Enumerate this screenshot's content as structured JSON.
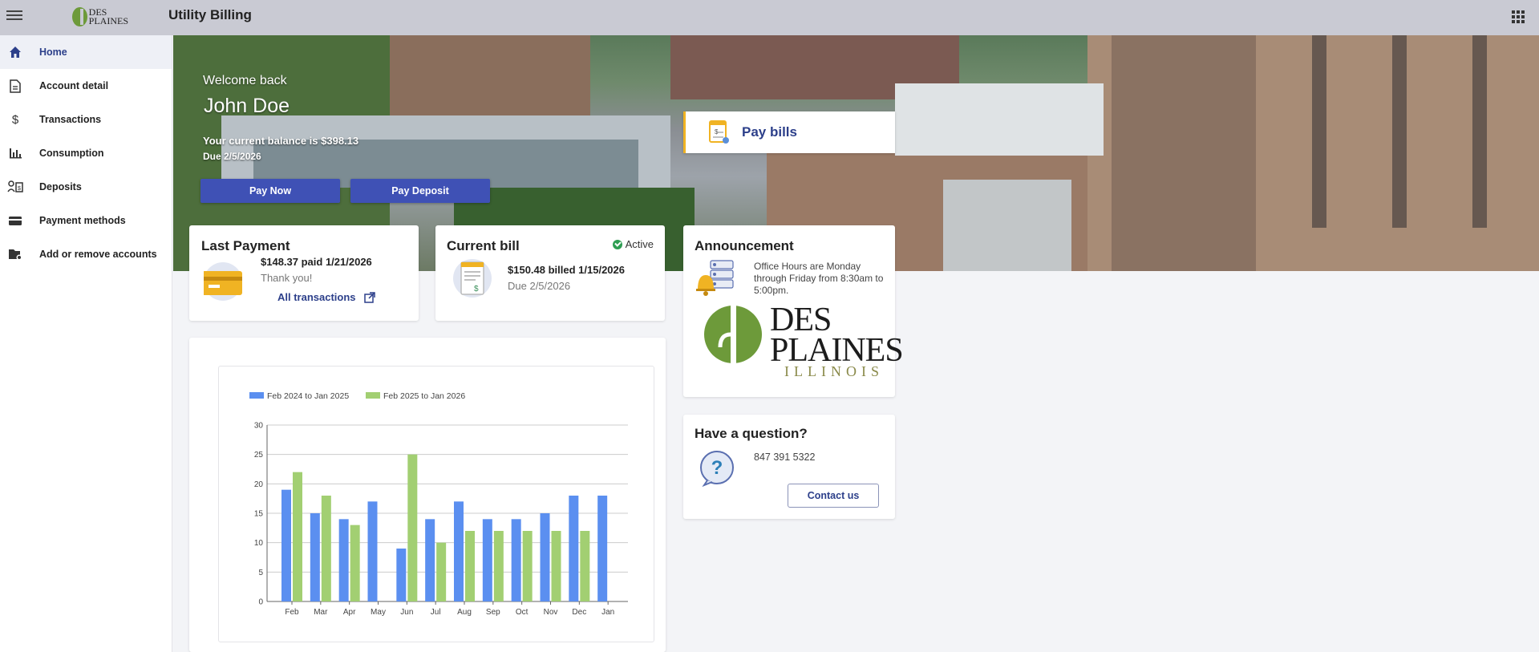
{
  "header": {
    "app_title": "Utility Billing",
    "logo_text_line1": "DES",
    "logo_text_line2": "PLAINES"
  },
  "sidebar": {
    "items": [
      {
        "label": "Home",
        "icon": "home-icon",
        "active": true
      },
      {
        "label": "Account detail",
        "icon": "document-icon",
        "active": false
      },
      {
        "label": "Transactions",
        "icon": "dollar-icon",
        "active": false
      },
      {
        "label": "Consumption",
        "icon": "bar-chart-icon",
        "active": false
      },
      {
        "label": "Deposits",
        "icon": "deposits-icon",
        "active": false
      },
      {
        "label": "Payment methods",
        "icon": "credit-card-icon",
        "active": false
      },
      {
        "label": "Add or remove accounts",
        "icon": "folder-settings-icon",
        "active": false
      }
    ]
  },
  "hero": {
    "welcome": "Welcome back",
    "name": "John Doe",
    "balance": "Your current balance is $398.13",
    "due": "Due 2/5/2026",
    "pay_now": "Pay Now",
    "pay_deposit": "Pay Deposit",
    "pay_bills": "Pay bills"
  },
  "last_payment": {
    "title": "Last Payment",
    "amount": "$148.37 paid 1/21/2026",
    "thanks": "Thank you!",
    "link": "All transactions"
  },
  "current_bill": {
    "title": "Current bill",
    "status": "Active",
    "amount": "$150.48 billed 1/15/2026",
    "due": "Due 2/5/2026"
  },
  "announcement": {
    "title": "Announcement",
    "text": "Office Hours are Monday through Friday from 8:30am to 5:00pm.",
    "logo_des": "DES",
    "logo_plaines": "PLAINES",
    "logo_state": "ILLINOIS"
  },
  "question": {
    "title": "Have a question?",
    "phone": "847 391 5322",
    "contact": "Contact us"
  },
  "colors": {
    "accent": "#3f51b5",
    "series1": "#5b8ff0",
    "series2": "#a2cf72",
    "brand_green": "#6d9a3a"
  },
  "chart_data": {
    "type": "bar",
    "categories": [
      "Feb",
      "Mar",
      "Apr",
      "May",
      "Jun",
      "Jul",
      "Aug",
      "Sep",
      "Oct",
      "Nov",
      "Dec",
      "Jan"
    ],
    "series": [
      {
        "name": "Feb 2024 to Jan 2025",
        "values": [
          19,
          15,
          14,
          17,
          9,
          14,
          17,
          14,
          14,
          15,
          18,
          18
        ]
      },
      {
        "name": "Feb 2025 to Jan 2026",
        "values": [
          22,
          18,
          13,
          null,
          25,
          10,
          12,
          12,
          12,
          12,
          12,
          null
        ]
      }
    ],
    "yticks": [
      0,
      5,
      10,
      15,
      20,
      25,
      30
    ],
    "ylim": [
      0,
      30
    ],
    "grid": true,
    "legend": "top-left"
  }
}
